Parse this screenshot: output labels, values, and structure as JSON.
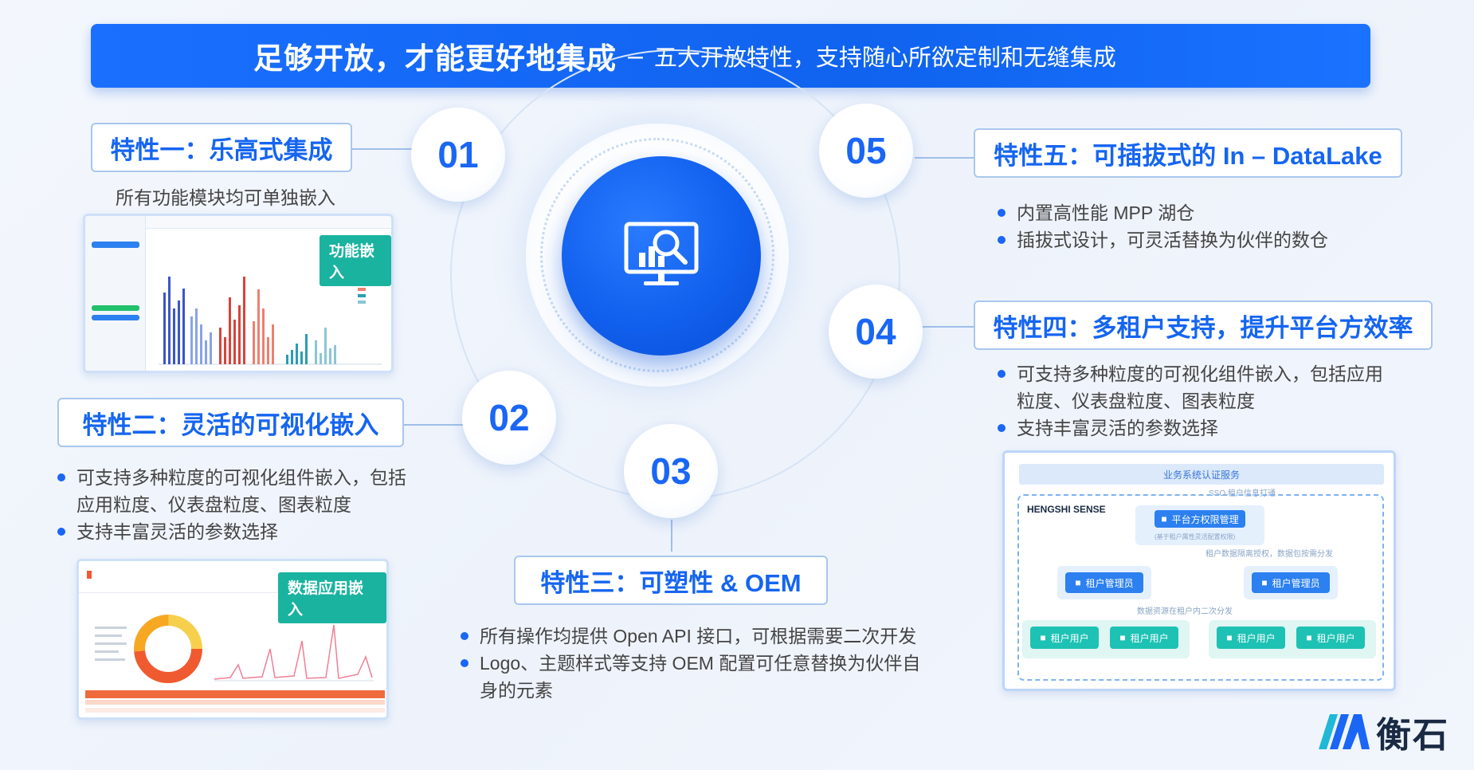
{
  "banner": {
    "title": "足够开放，才能更好地集成",
    "dash": "–",
    "subtitle": "五大开放特性，支持随心所欲定制和无缝集成"
  },
  "hub": {
    "icon": "data-analysis-monitor-icon"
  },
  "numbers": [
    "01",
    "02",
    "03",
    "04",
    "05"
  ],
  "features": {
    "f1": {
      "title": "特性一：乐高式集成",
      "caption": "所有功能模块均可单独嵌入",
      "tag": "功能嵌入"
    },
    "f2": {
      "title": "特性二：灵活的可视化嵌入",
      "bullets": [
        "可支持多种粒度的可视化组件嵌入，包括",
        "应用粒度、仪表盘粒度、图表粒度",
        "支持丰富灵活的参数选择"
      ],
      "tag": "数据应用嵌入"
    },
    "f3": {
      "title": "特性三：可塑性 & OEM",
      "bullets": [
        "所有操作均提供 Open API 接口，可根据需要二次开发",
        "Logo、主题样式等支持 OEM 配置可任意替换为伙伴自",
        "身的元素"
      ]
    },
    "f4": {
      "title": "特性四：多租户支持，提升平台方效率",
      "bullets": [
        "可支持多种粒度的可视化组件嵌入，包括应用",
        "粒度、仪表盘粒度、图表粒度",
        "支持丰富灵活的参数选择"
      ]
    },
    "f5": {
      "title": "特性五：可插拔式的 In – DataLake",
      "bullets": [
        "内置高性能 MPP 湖仓",
        "插拔式设计，可灵活替换为伙伴的数仓"
      ]
    }
  },
  "tenant_diagram": {
    "header": "业务系统认证服务",
    "sso": "SSO 租户信息打通",
    "brand": "HENGSHI SENSE",
    "platform_admin": "平台方权限管理",
    "platform_note": "(基于租户属性灵活配置权限)",
    "note1": "租户数据隔离授权，数据包按需分发",
    "tenant_admin": "租户管理员",
    "note2": "数据资源在租户内二次分发",
    "tenant_user": "租户用户"
  },
  "logo": {
    "text": "衡石"
  },
  "colors": {
    "primary": "#1a66f5",
    "teal": "#1ab3a0"
  }
}
